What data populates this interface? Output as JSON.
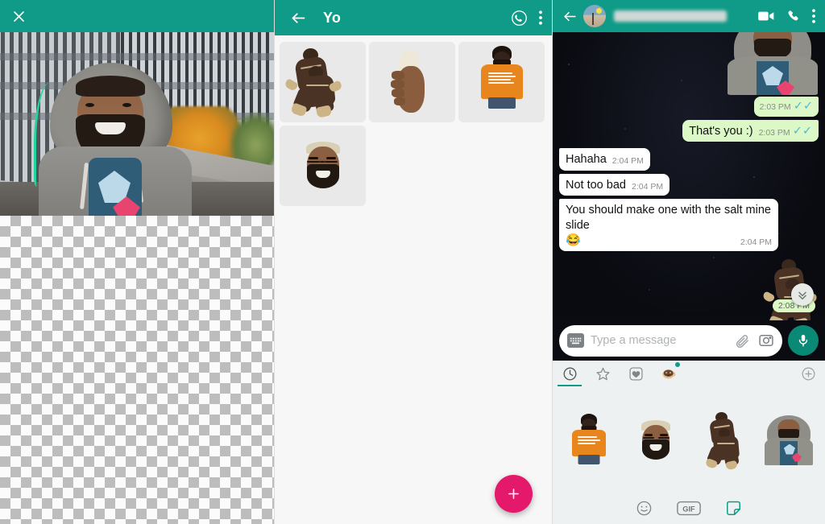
{
  "editor": {
    "close_label": "✕",
    "close_icon": "close-icon",
    "canvas_hint": "transparent-checkerboard"
  },
  "pack": {
    "title": "Yo",
    "back_icon": "back-arrow-icon",
    "whatsapp_icon": "whatsapp-icon",
    "overflow_icon": "more-vertical-icon",
    "add_label": "+",
    "stickers": [
      {
        "name": "brown-suit-duo-sticker"
      },
      {
        "name": "hand-holding-bulb-sticker"
      },
      {
        "name": "orange-tshirt-man-sticker"
      },
      {
        "name": "bearded-face-sticker"
      }
    ]
  },
  "chat": {
    "contact_name": "",
    "contact_name_redacted": true,
    "back_icon": "back-arrow-icon",
    "video_call_icon": "video-camera-icon",
    "voice_call_icon": "phone-icon",
    "overflow_icon": "more-vertical-icon",
    "messages": [
      {
        "kind": "sticker",
        "direction": "out",
        "sticker": "hoodie-man-sticker",
        "time": "2:03 PM",
        "status": "read"
      },
      {
        "kind": "text",
        "direction": "out",
        "text": "That's you :)",
        "time": "2:03 PM",
        "status": "read"
      },
      {
        "kind": "text",
        "direction": "in",
        "text": "Hahaha",
        "time": "2:04 PM"
      },
      {
        "kind": "text",
        "direction": "in",
        "text": "Not too bad",
        "time": "2:04 PM"
      },
      {
        "kind": "text",
        "direction": "in",
        "text": "You should make one with the salt mine slide",
        "emoji": "😂",
        "time": "2:04 PM"
      },
      {
        "kind": "sticker",
        "direction": "out",
        "sticker": "brown-suit-duo-sticker",
        "time": "2:08 PM"
      }
    ],
    "last_sticker_time": "2:08 PM",
    "scroll_down_icon": "chevron-double-down-icon",
    "input": {
      "placeholder": "Type a message",
      "value": "",
      "keyboard_icon": "keyboard-icon",
      "attach_icon": "paperclip-icon",
      "camera_icon": "camera-icon",
      "mic_icon": "microphone-icon"
    },
    "sticker_tray": {
      "tabs": [
        {
          "name": "recents-tab",
          "icon": "clock-icon",
          "active": true,
          "badge": false
        },
        {
          "name": "starred-tab",
          "icon": "star-icon",
          "active": false,
          "badge": false
        },
        {
          "name": "favorites-tab",
          "icon": "heart-icon",
          "active": false,
          "badge": false
        },
        {
          "name": "pack-coffee-tab",
          "icon": "coffee-cup-icon",
          "active": false,
          "badge": true
        }
      ],
      "add_icon": "plus-circle-icon",
      "stickers": [
        {
          "name": "orange-tshirt-man-sticker"
        },
        {
          "name": "bearded-face-sticker"
        },
        {
          "name": "brown-suit-duo-sticker"
        },
        {
          "name": "hoodie-man-sticker"
        }
      ]
    },
    "bottom_bar": [
      {
        "name": "emoji-tab",
        "icon": "smiley-icon",
        "label": "",
        "active": false
      },
      {
        "name": "gif-tab",
        "icon": "gif-icon",
        "label": "GIF",
        "active": false
      },
      {
        "name": "sticker-tab",
        "icon": "sticker-icon",
        "label": "",
        "active": true
      }
    ]
  },
  "colors": {
    "teal_header": "#0f9b87",
    "accent_pink": "#e5196b",
    "bubble_out": "#dcf8c6",
    "bubble_in": "#ffffff",
    "tick_blue": "#4fb8d6",
    "tray_bg": "#eef1f2"
  }
}
